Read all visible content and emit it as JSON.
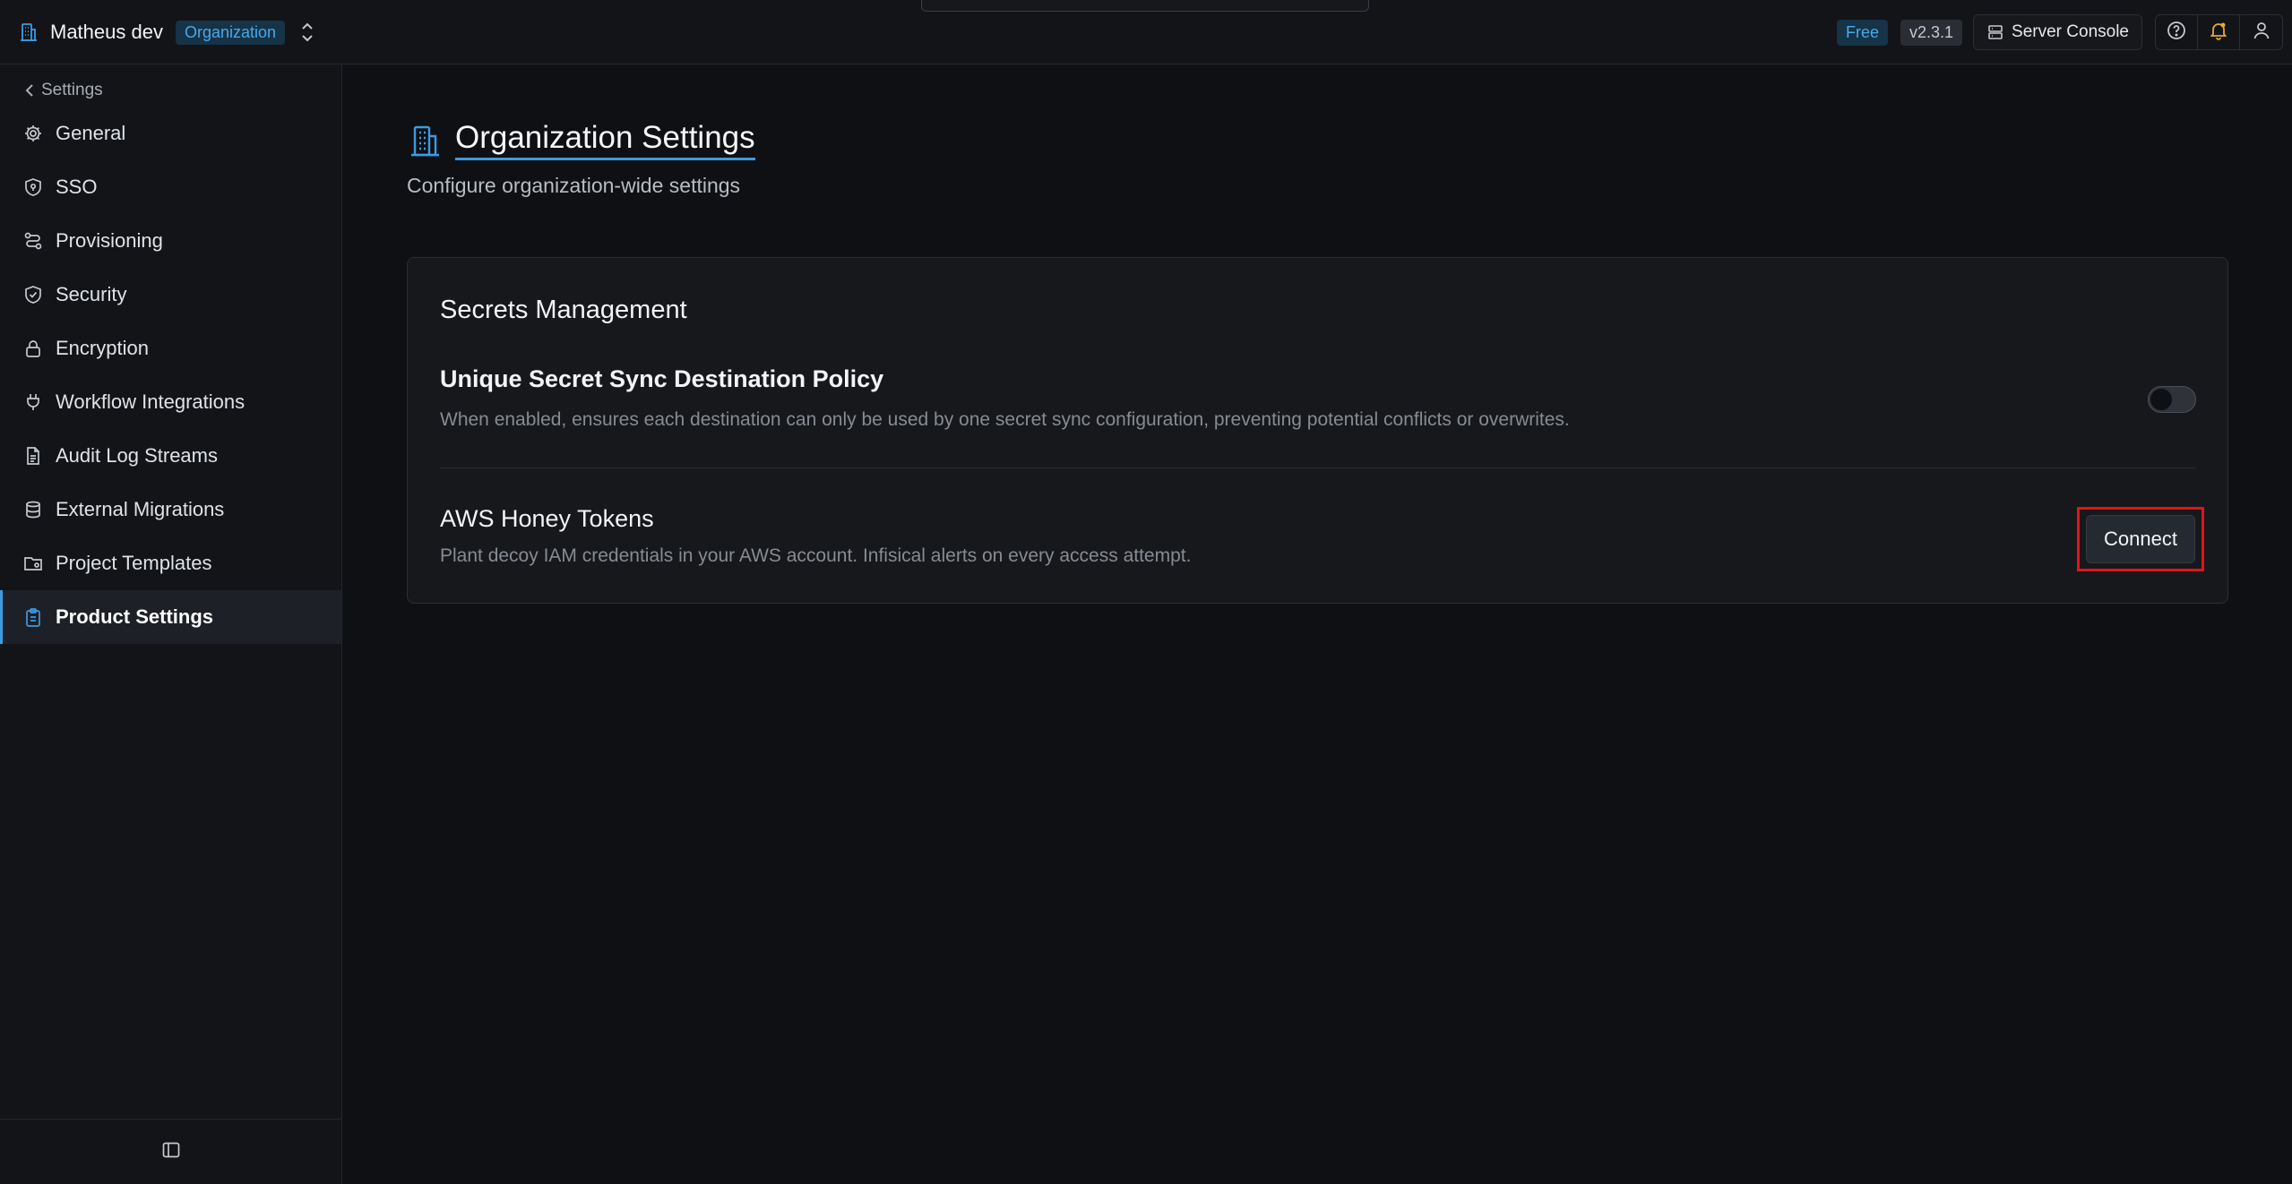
{
  "topbar": {
    "org_name": "Matheus dev",
    "org_badge": "Organization",
    "plan_badge": "Free",
    "version_badge": "v2.3.1",
    "server_console_label": "Server Console"
  },
  "sidebar": {
    "back_label": "Settings",
    "items": [
      {
        "label": "General",
        "icon": "gear-icon"
      },
      {
        "label": "SSO",
        "icon": "shield-key-icon"
      },
      {
        "label": "Provisioning",
        "icon": "workflow-icon"
      },
      {
        "label": "Security",
        "icon": "shield-check-icon"
      },
      {
        "label": "Encryption",
        "icon": "lock-icon"
      },
      {
        "label": "Workflow Integrations",
        "icon": "plug-icon"
      },
      {
        "label": "Audit Log Streams",
        "icon": "document-icon"
      },
      {
        "label": "External Migrations",
        "icon": "database-icon"
      },
      {
        "label": "Project Templates",
        "icon": "folder-cog-icon"
      },
      {
        "label": "Product Settings",
        "icon": "clipboard-icon",
        "active": true
      }
    ]
  },
  "main": {
    "title": "Organization Settings",
    "subtitle": "Configure organization-wide settings",
    "card": {
      "title": "Secrets Management",
      "settings": [
        {
          "name": "Unique Secret Sync Destination Policy",
          "description": "When enabled, ensures each destination can only be used by one secret sync configuration, preventing potential conflicts or overwrites.",
          "control": "toggle",
          "enabled": false
        },
        {
          "name": "AWS Honey Tokens",
          "description": "Plant decoy IAM credentials in your AWS account. Infisical alerts on every access attempt.",
          "control": "button",
          "button_label": "Connect"
        }
      ]
    }
  },
  "colors": {
    "accent": "#3b9be3",
    "highlight_border": "#e0141b",
    "background": "#0e1014"
  }
}
